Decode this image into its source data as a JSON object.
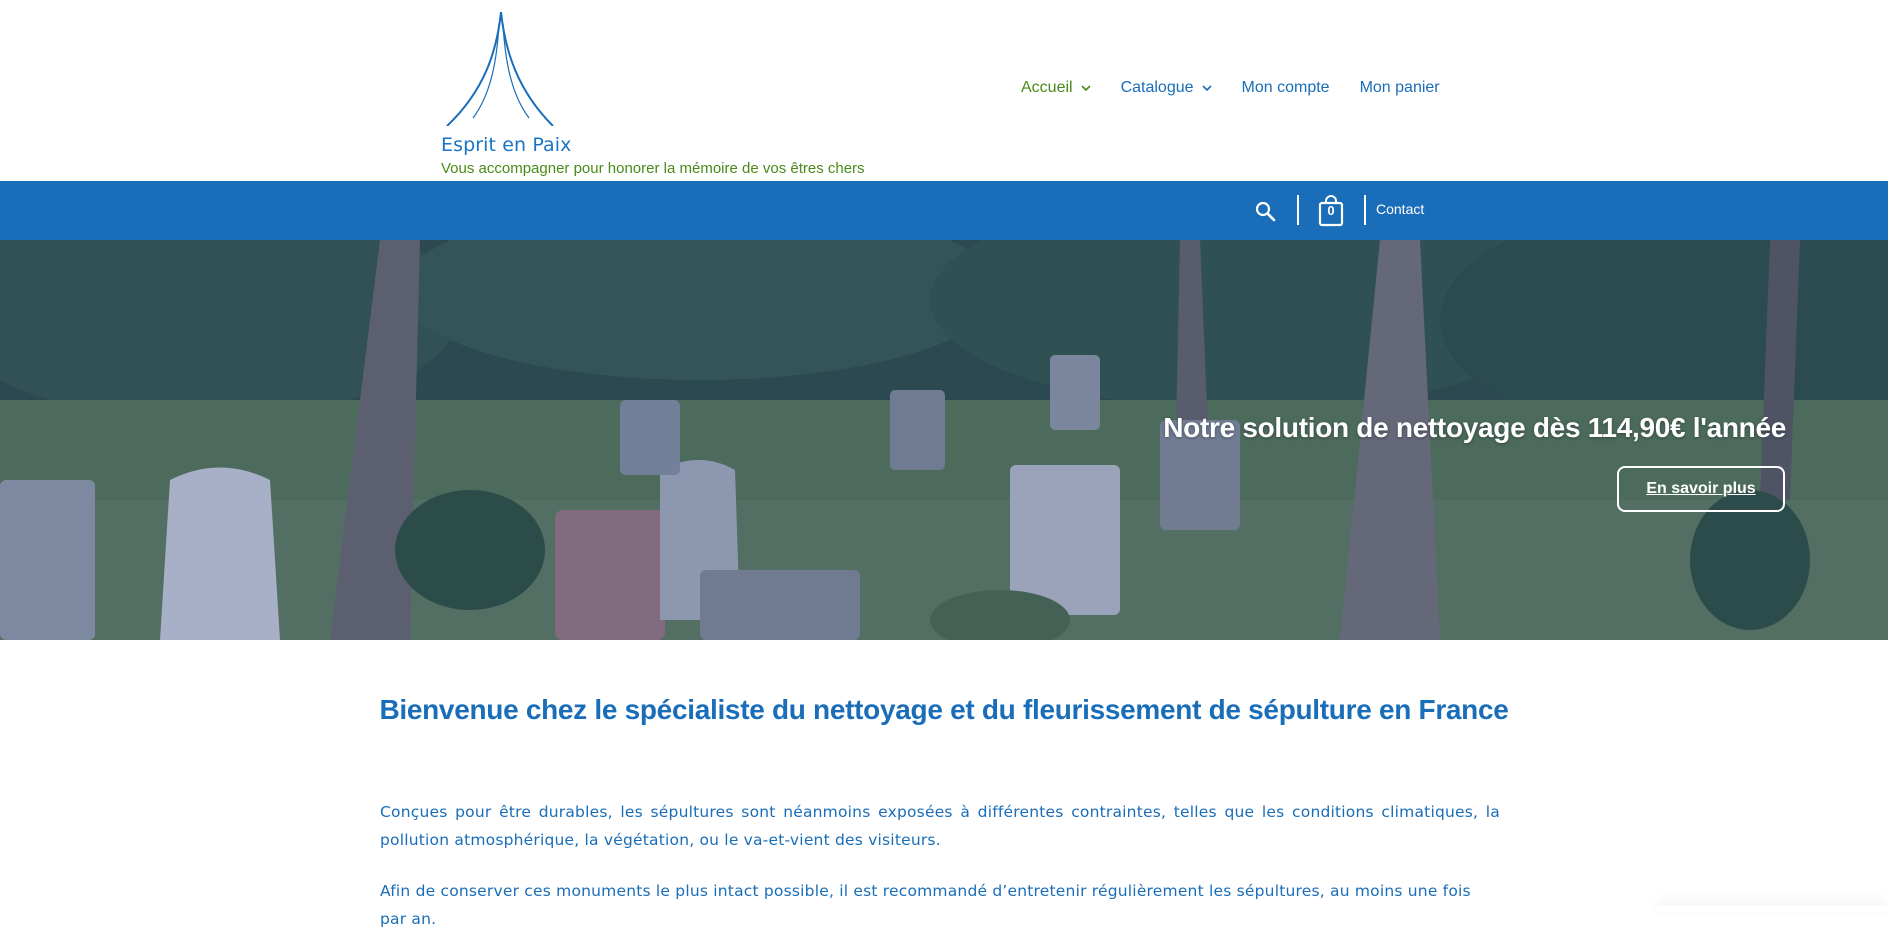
{
  "site": {
    "brand_name": "Esprit en Paix",
    "tagline": "Vous accompagner pour honorer la mémoire de vos êtres chers"
  },
  "nav": {
    "items": [
      {
        "label": "Accueil",
        "has_dropdown": true,
        "active": true
      },
      {
        "label": "Catalogue",
        "has_dropdown": true,
        "active": false
      },
      {
        "label": "Mon compte",
        "has_dropdown": false,
        "active": false
      },
      {
        "label": "Mon panier",
        "has_dropdown": false,
        "active": false
      }
    ]
  },
  "topbar": {
    "search_icon": "search-icon",
    "cart_icon": "shopping-bag-icon",
    "cart_count": "0",
    "contact_label": "Contact"
  },
  "hero": {
    "title": "Notre solution de nettoyage dès 114,90€ l'année",
    "button_label": "En savoir plus"
  },
  "content": {
    "heading": "Bienvenue chez le spécialiste du nettoyage et du fleurissement de sépulture en France",
    "paragraph1": "Conçues pour être durables, les sépultures sont néanmoins exposées à différentes contraintes, telles que les conditions climatiques, la pollution atmosphérique, la végétation, ou le va-et-vient des visiteurs.",
    "paragraph2": "Afin de conserver ces monuments le plus intact possible, il est recommandé d’entretenir régulièrement les sépultures, au moins une fois par an."
  },
  "colors": {
    "primary_blue": "#1a6db8",
    "accent_green": "#4a8a18",
    "white": "#ffffff"
  }
}
